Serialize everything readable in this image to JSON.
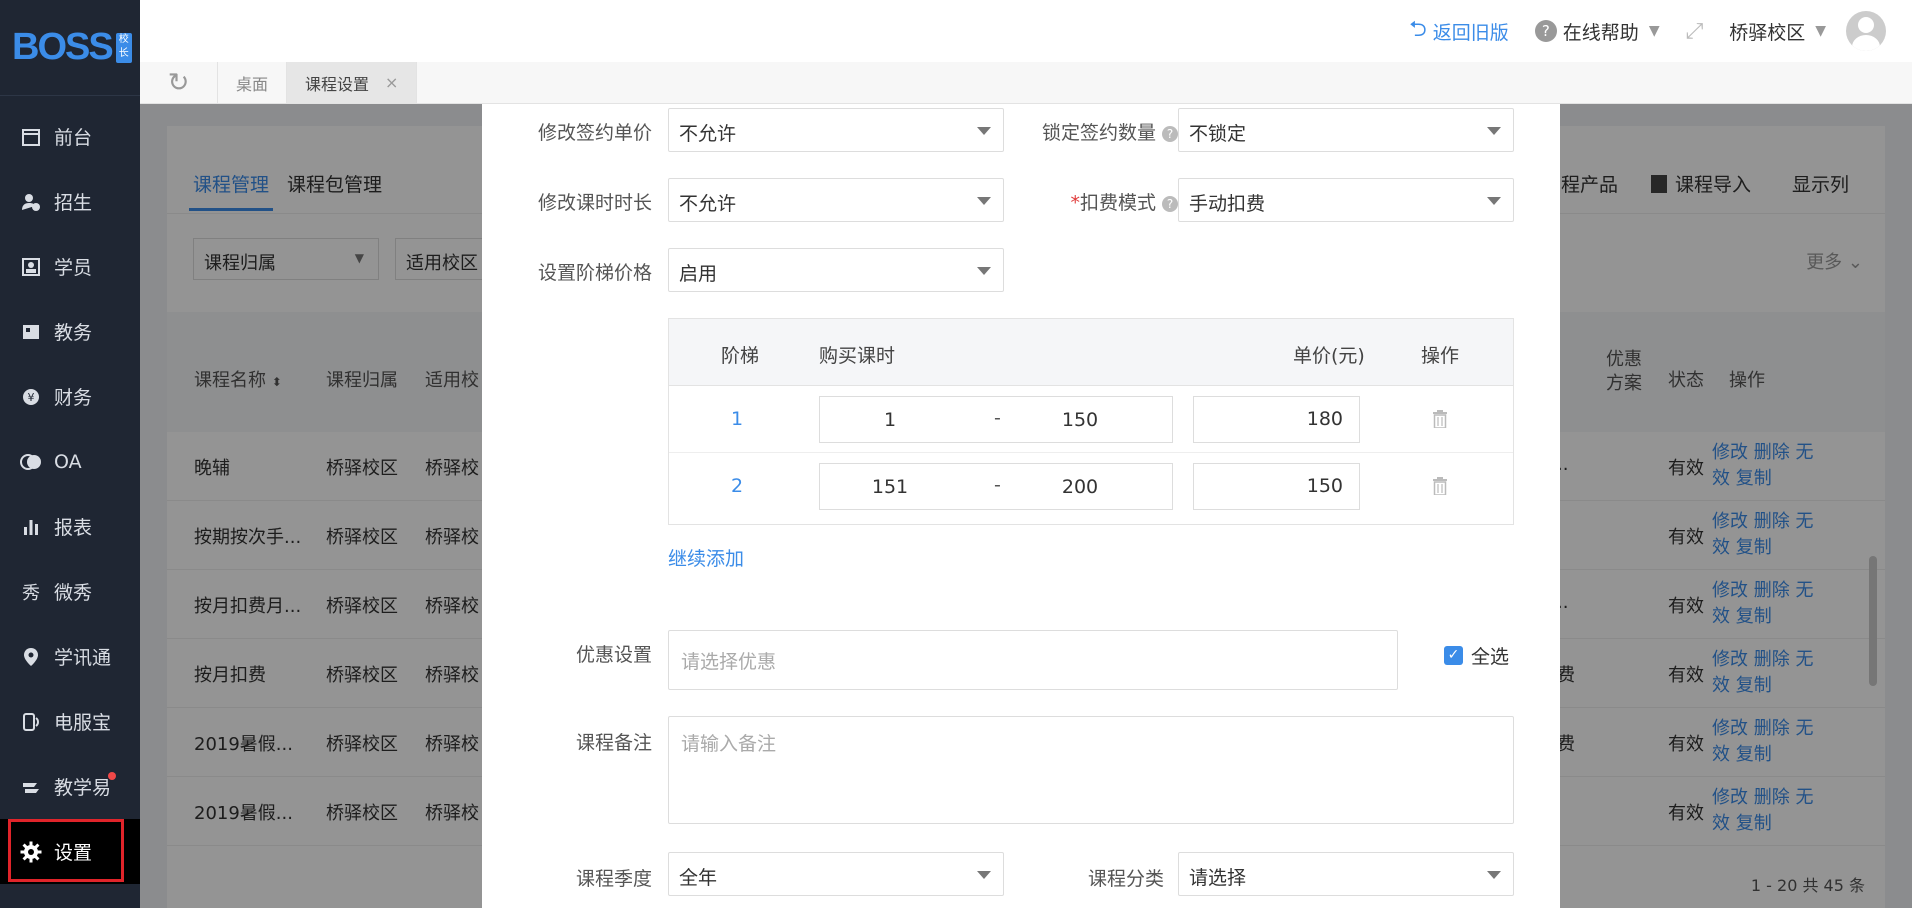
{
  "logo": {
    "text": "BOSS",
    "badge": "校长"
  },
  "sidebar": {
    "items": [
      {
        "label": "前台",
        "icon": "calendar-icon"
      },
      {
        "label": "招生",
        "icon": "user-add-icon"
      },
      {
        "label": "学员",
        "icon": "id-card-icon"
      },
      {
        "label": "教务",
        "icon": "book-icon"
      },
      {
        "label": "财务",
        "icon": "yen-icon"
      },
      {
        "label": "OA",
        "icon": "oa-icon"
      },
      {
        "label": "报表",
        "icon": "bar-chart-icon"
      },
      {
        "label": "微秀",
        "icon": "weixiu-icon"
      },
      {
        "label": "学讯通",
        "icon": "location-icon"
      },
      {
        "label": "电服宝",
        "icon": "phone-service-icon"
      },
      {
        "label": "教学易",
        "icon": "teach-icon"
      },
      {
        "label": "设置",
        "icon": "gear-icon"
      }
    ]
  },
  "topbar": {
    "back_old": "返回旧版",
    "help": "在线帮助",
    "campus": "桥驿校区"
  },
  "tabs": {
    "desk": "桌面",
    "course_settings": "课程设置",
    "close": "×"
  },
  "page": {
    "subtabs": [
      "课程管理",
      "课程包管理"
    ],
    "actions": [
      "程产品",
      "课程导入",
      "显示列"
    ],
    "filters": [
      "课程归属",
      "适用校区"
    ],
    "more": "更多",
    "headers": [
      "课程名称",
      "课程归属",
      "适用校",
      "优惠方案",
      "状态",
      "操作"
    ],
    "rows": [
      {
        "name": "晚辅",
        "owner": "桥驿校区",
        "campus": "桥驿校",
        "promo": "..",
        "status": "有效"
      },
      {
        "name": "按期按次手...",
        "owner": "桥驿校区",
        "campus": "桥驿校",
        "promo": "",
        "status": "有效"
      },
      {
        "name": "按月扣费月...",
        "owner": "桥驿校区",
        "campus": "桥驿校",
        "promo": "..",
        "status": "有效"
      },
      {
        "name": "按月扣费",
        "owner": "桥驿校区",
        "campus": "桥驿校",
        "promo": "费",
        "status": "有效"
      },
      {
        "name": "2019暑假...",
        "owner": "桥驿校区",
        "campus": "桥驿校",
        "promo": "费",
        "status": "有效"
      },
      {
        "name": "2019暑假...",
        "owner": "桥驿校区",
        "campus": "桥驿校",
        "promo": "",
        "status": "有效"
      }
    ],
    "ops_line1": "修改 删除 无",
    "ops_line2": "效 复制",
    "pager": "1 - 20   共 45 条"
  },
  "modal": {
    "modify_unit_price": {
      "label": "修改签约单价",
      "value": "不允许"
    },
    "lock_quantity": {
      "label": "锁定签约数量",
      "value": "不锁定"
    },
    "modify_duration": {
      "label": "修改课时时长",
      "value": "不允许"
    },
    "charge_mode": {
      "label": "扣费模式",
      "required": "*",
      "value": "手动扣费"
    },
    "tier_price": {
      "label": "设置阶梯价格",
      "value": "启用"
    },
    "tier_table": {
      "headers": [
        "阶梯",
        "购买课时",
        "单价(元)",
        "操作"
      ],
      "rows": [
        {
          "tier": "1",
          "from": "1",
          "sep": "-",
          "to": "150",
          "price": "180"
        },
        {
          "tier": "2",
          "from": "151",
          "sep": "-",
          "to": "200",
          "price": "150"
        }
      ]
    },
    "add_more": "继续添加",
    "discount": {
      "label": "优惠设置",
      "placeholder": "请选择优惠",
      "select_all": "全选"
    },
    "remark": {
      "label": "课程备注",
      "placeholder": "请输入备注"
    },
    "season": {
      "label": "课程季度",
      "value": "全年"
    },
    "category": {
      "label": "课程分类",
      "value": "请选择"
    }
  }
}
